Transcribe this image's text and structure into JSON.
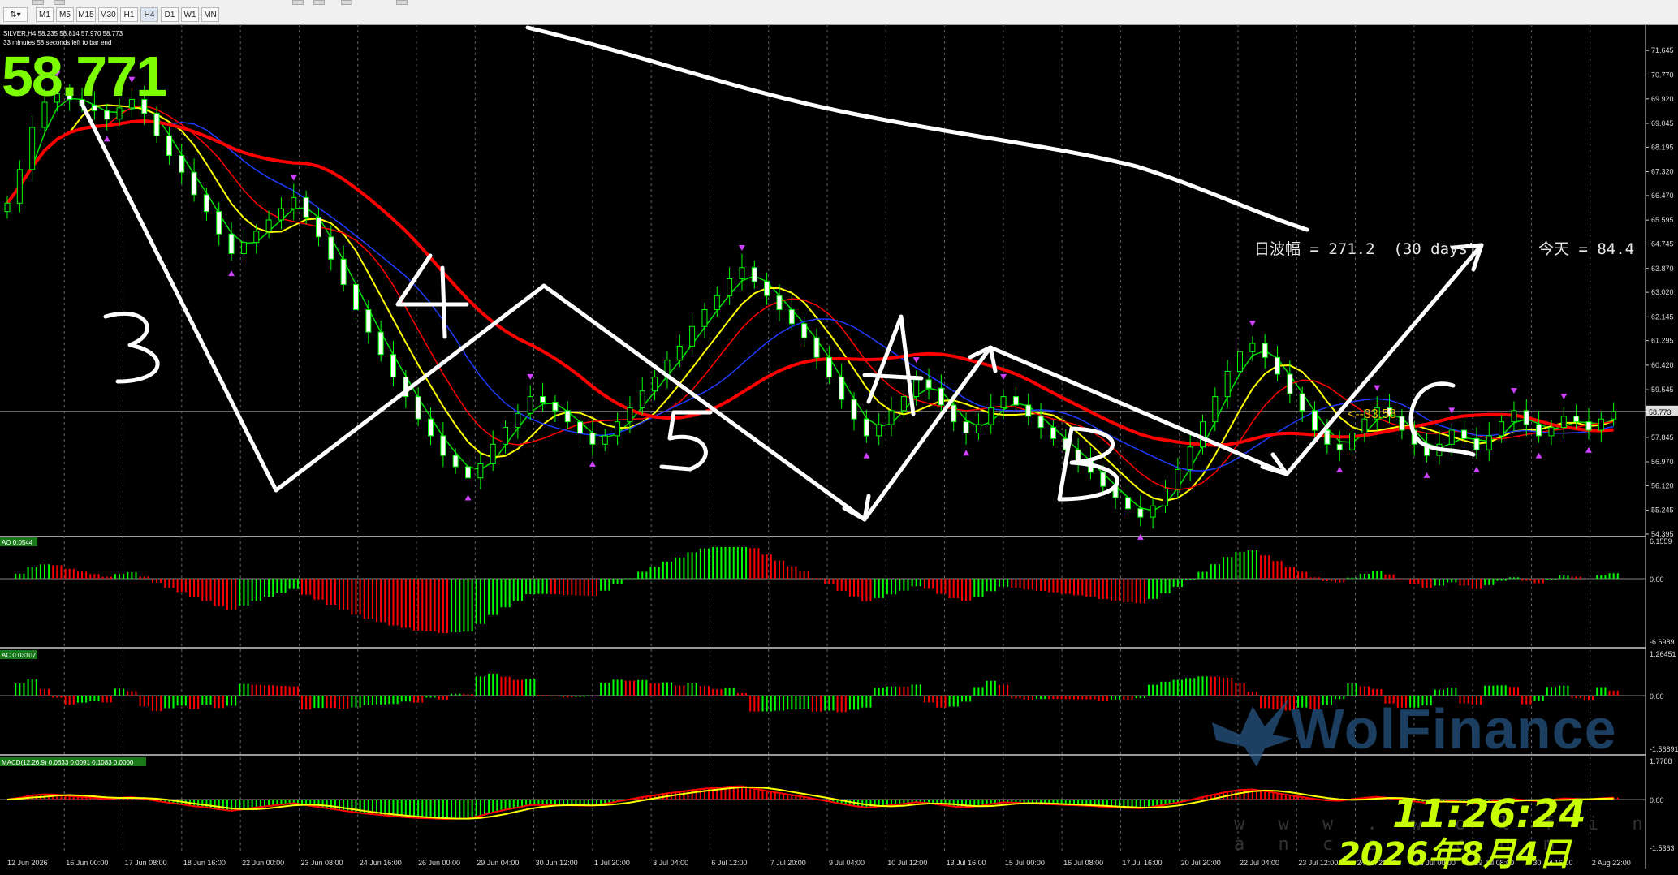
{
  "toolbar": {
    "timeframes": [
      "M1",
      "M5",
      "M15",
      "M30",
      "H1",
      "H4",
      "D1",
      "W1",
      "MN"
    ]
  },
  "chart": {
    "symbol_line": "SILVER,H4  58.235 58.814 57.970 58.773",
    "countdown_line": "33 minutes 58 seconds left to bar end",
    "big_price": "58.771",
    "current_price_label": "58.773",
    "countdown_marker": "<--33:58",
    "amplitude_text": "日波幅 = 271.2  (30 days)",
    "today_text": "今天 = 84.4",
    "clock": "11:26:24",
    "date": "2026年8月4日",
    "watermark": "WolFinance",
    "watermark_url": "w w w . w o l f i n a n c e . c o m",
    "wave_labels": [
      "3",
      "4",
      "5",
      "A",
      "B",
      "C"
    ],
    "colors": {
      "up": "#00ff00",
      "down": "#ff0000",
      "ma_red": "#ff0000",
      "ma_blue": "#1e3cff",
      "ma_yellow": "#ffff00",
      "ma_green": "#00e000",
      "signal": "#ffff00"
    }
  },
  "chart_data": {
    "type": "candlestick",
    "symbol": "SILVER",
    "timeframe": "H4",
    "price_axis": {
      "min": 54.395,
      "max": 72.52,
      "ticks": [
        "71.645",
        "70.770",
        "69.920",
        "69.045",
        "68.195",
        "67.320",
        "66.470",
        "65.595",
        "64.745",
        "63.870",
        "63.020",
        "62.145",
        "61.295",
        "60.420",
        "59.545",
        "58.773",
        "57.845",
        "56.970",
        "56.120",
        "55.245",
        "54.395"
      ]
    },
    "date_ticks": [
      "12 Jun 2026",
      "16 Jun 00:00",
      "17 Jun 08:00",
      "18 Jun 16:00",
      "22 Jun 00:00",
      "23 Jun 08:00",
      "24 Jun 16:00",
      "26 Jun 00:00",
      "29 Jun 04:00",
      "30 Jun 12:00",
      "1 Jul 20:00",
      "3 Jul 04:00",
      "6 Jul 12:00",
      "7 Jul 20:00",
      "9 Jul 04:00",
      "10 Jul 12:00",
      "13 Jul 16:00",
      "15 Jul 00:00",
      "16 Jul 08:00",
      "17 Jul 16:00",
      "20 Jul 20:00",
      "22 Jul 04:00",
      "23 Jul 12:00",
      "24 Jul 20:00",
      "28 Jul 00:00",
      "29 Jul 08:00",
      "30 Jul 16:00",
      "2 Aug 22:00"
    ],
    "close": [
      66.2,
      67.4,
      68.9,
      69.8,
      70.1,
      69.9,
      69.7,
      69.5,
      69.2,
      69.6,
      69.9,
      69.4,
      68.6,
      67.9,
      67.3,
      66.5,
      65.9,
      65.1,
      64.4,
      64.8,
      65.2,
      65.6,
      66.0,
      66.4,
      65.7,
      65.0,
      64.2,
      63.3,
      62.4,
      61.6,
      60.8,
      60.0,
      59.3,
      58.5,
      57.9,
      57.2,
      56.8,
      56.4,
      56.9,
      57.6,
      58.2,
      58.7,
      59.3,
      59.1,
      58.8,
      58.4,
      58.0,
      57.6,
      57.9,
      58.4,
      58.9,
      59.5,
      60.0,
      60.6,
      61.1,
      61.8,
      62.4,
      62.9,
      63.5,
      63.9,
      63.4,
      62.9,
      62.4,
      61.9,
      61.4,
      60.7,
      60.0,
      59.2,
      58.5,
      57.9,
      58.3,
      58.8,
      59.3,
      59.9,
      59.6,
      59.0,
      58.4,
      58.0,
      58.3,
      58.9,
      59.3,
      59.0,
      58.6,
      58.2,
      57.8,
      57.4,
      57.0,
      56.6,
      56.1,
      55.7,
      55.3,
      55.0,
      55.4,
      56.0,
      56.7,
      57.5,
      58.4,
      59.3,
      60.2,
      60.9,
      61.2,
      60.7,
      60.1,
      59.4,
      58.8,
      58.1,
      57.6,
      57.4,
      58.0,
      58.5,
      58.9,
      58.6,
      58.1,
      57.6,
      57.2,
      57.6,
      58.1,
      57.8,
      57.4,
      57.9,
      58.4,
      58.8,
      58.3,
      57.9,
      58.2,
      58.6,
      58.4,
      58.1,
      58.5,
      58.77
    ],
    "indicators": {
      "AO": {
        "label": "AO 0.0544",
        "axis": [
          "6.1559",
          "0.00",
          "-6.6989"
        ]
      },
      "AC": {
        "label": "AC 0.03107",
        "axis": [
          "1.26451",
          "0.00",
          "-1.56891"
        ]
      },
      "MACD": {
        "label": "MACD(12,26,9) 0.0633 0.0091 0.1083 0.0000",
        "axis": [
          "1.7788",
          "0.00",
          "-1.5363"
        ]
      }
    }
  }
}
